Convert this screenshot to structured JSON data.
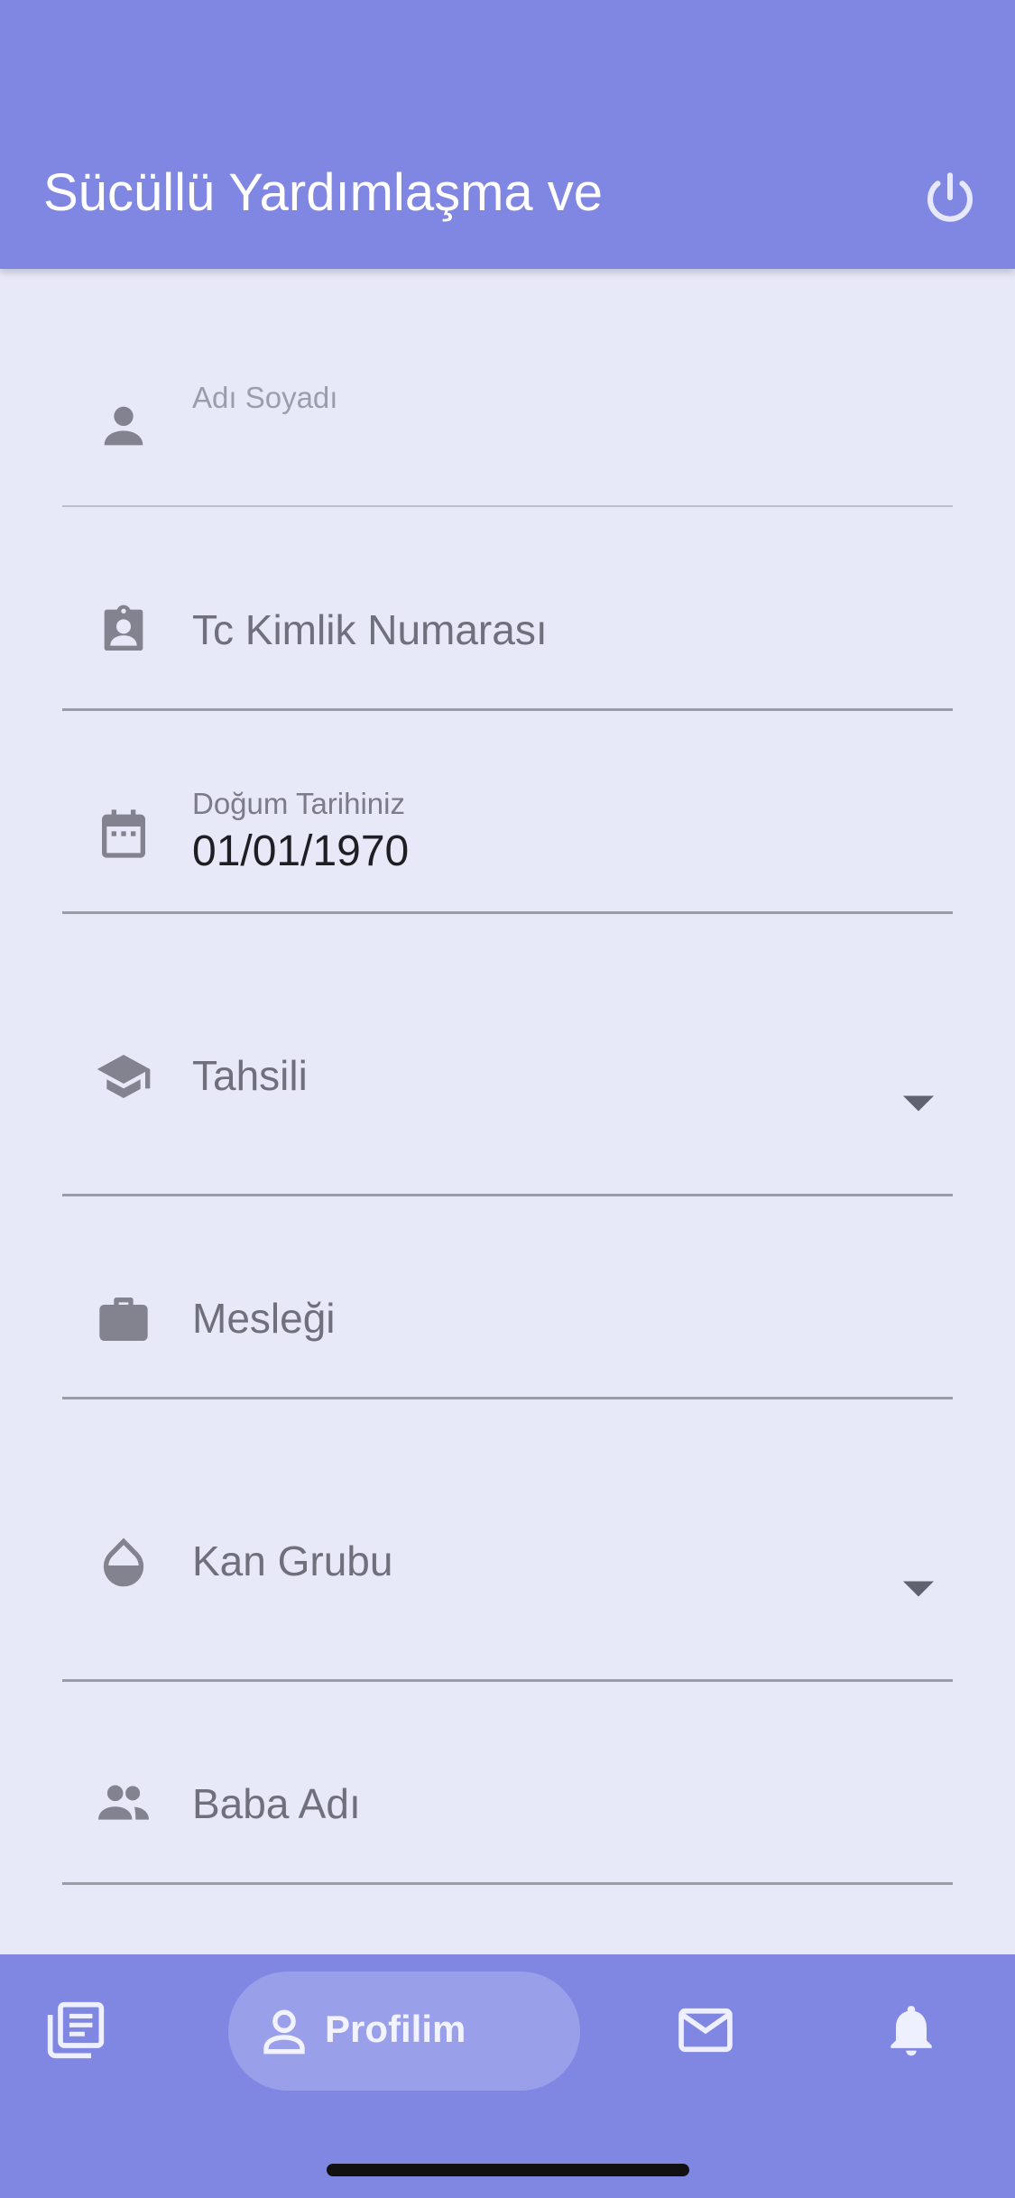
{
  "app_bar": {
    "title": "Sücüllü Yardımlaşma ve",
    "logout_icon": "power-icon"
  },
  "form": {
    "full_name": {
      "label": "Adı Soyadı",
      "value": "",
      "icon": "person-icon"
    },
    "tc_number": {
      "placeholder": "Tc Kimlik Numarası",
      "icon": "id-badge-icon"
    },
    "birth_date": {
      "label": "Doğum Tarihiniz",
      "value": "01/01/1970",
      "icon": "calendar-icon"
    },
    "education": {
      "placeholder": "Tahsili",
      "icon": "graduation-cap-icon"
    },
    "profession": {
      "placeholder": "Mesleği",
      "icon": "briefcase-icon"
    },
    "blood_type": {
      "placeholder": "Kan Grubu",
      "icon": "drop-icon"
    },
    "father_name": {
      "placeholder": "Baba Adı",
      "icon": "people-icon"
    }
  },
  "bottom_nav": {
    "items": [
      {
        "id": "news",
        "icon": "news-icon",
        "active": false
      },
      {
        "id": "profile",
        "icon": "person-outline-icon",
        "label": "Profilim",
        "active": true
      },
      {
        "id": "messages",
        "icon": "mail-icon",
        "active": false
      },
      {
        "id": "notifications",
        "icon": "bell-icon",
        "active": false
      }
    ]
  },
  "colors": {
    "primary": "#8087e2",
    "background": "#e8e9f8",
    "icon_gray": "#82838e",
    "active_pill": "#9a9fe9"
  }
}
